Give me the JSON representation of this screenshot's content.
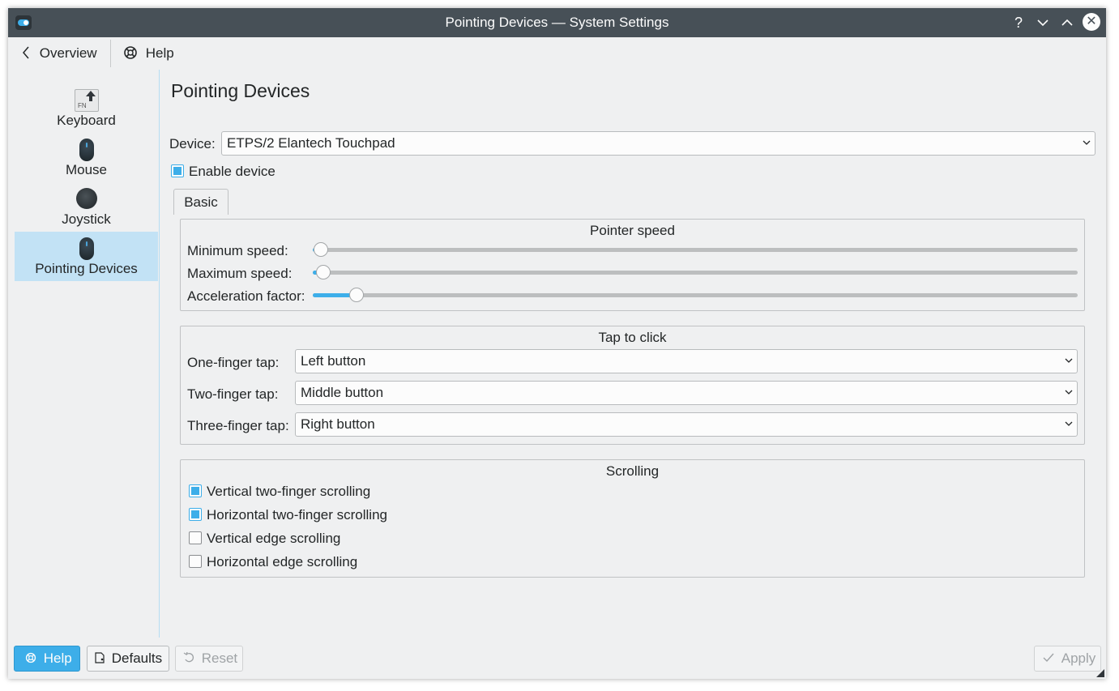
{
  "window": {
    "title": "Pointing Devices  — System Settings"
  },
  "titlebar_buttons": {
    "help": "?",
    "minimize": "⌄",
    "maximize": "⌃",
    "close": "✕"
  },
  "toolbar": {
    "overview_label": "Overview",
    "help_label": "Help"
  },
  "sidebar": {
    "items": [
      {
        "label": "Keyboard",
        "icon": "keyboard-fn-icon",
        "selected": false
      },
      {
        "label": "Mouse",
        "icon": "mouse-icon",
        "selected": false
      },
      {
        "label": "Joystick",
        "icon": "joystick-icon",
        "selected": false
      },
      {
        "label": "Pointing Devices",
        "icon": "pointing-device-icon",
        "selected": true
      }
    ]
  },
  "main": {
    "page_title": "Pointing Devices",
    "device_label": "Device:",
    "device_value": "ETPS/2 Elantech Touchpad",
    "enable_device_label": "Enable device",
    "enable_device_checked": true,
    "tabs": [
      {
        "label": "Basic",
        "active": true
      }
    ],
    "pointer_speed": {
      "title": "Pointer speed",
      "sliders": [
        {
          "label": "Minimum speed:",
          "value": 0.01
        },
        {
          "label": "Maximum speed:",
          "value": 0.015
        },
        {
          "label": "Acceleration factor:",
          "value": 0.058
        }
      ]
    },
    "tap_to_click": {
      "title": "Tap to click",
      "rows": [
        {
          "label": "One-finger tap:",
          "value": "Left button"
        },
        {
          "label": "Two-finger tap:",
          "value": "Middle button"
        },
        {
          "label": "Three-finger tap:",
          "value": "Right button"
        }
      ]
    },
    "scrolling": {
      "title": "Scrolling",
      "options": [
        {
          "label": "Vertical two-finger scrolling",
          "checked": true
        },
        {
          "label": "Horizontal two-finger scrolling",
          "checked": true
        },
        {
          "label": "Vertical edge scrolling",
          "checked": false
        },
        {
          "label": "Horizontal edge scrolling",
          "checked": false
        }
      ]
    }
  },
  "footer": {
    "help_label": "Help",
    "defaults_label": "Defaults",
    "reset_label": "Reset",
    "apply_label": "Apply"
  },
  "colors": {
    "accent": "#3daee9",
    "titlebar": "#475057",
    "selection": "#c2e2f5",
    "background": "#eff0f1"
  }
}
